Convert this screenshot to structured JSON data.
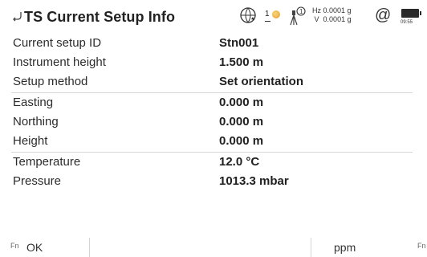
{
  "header": {
    "title": "TS Current Setup Info",
    "gnss_count": "1",
    "hz_label": "Hz",
    "hz_value": "0.0001 g",
    "v_label": "V",
    "v_value": "0.0001 g",
    "at_symbol": "@",
    "time": "09:55",
    "icons": [
      "back-icon",
      "globe-icon",
      "satellite-icon",
      "instrument-icon",
      "at-icon",
      "battery-icon"
    ]
  },
  "rows": [
    {
      "label": "Current setup ID",
      "value": "Stn001"
    },
    {
      "label": "Instrument height",
      "value": "1.500 m"
    },
    {
      "label": "Setup method",
      "value": "Set orientation"
    },
    {
      "label": "Easting",
      "value": "0.000 m"
    },
    {
      "label": "Northing",
      "value": "0.000 m"
    },
    {
      "label": "Height",
      "value": "0.000 m"
    },
    {
      "label": "Temperature",
      "value": "12.0 °C"
    },
    {
      "label": "Pressure",
      "value": "1013.3 mbar"
    }
  ],
  "footer": {
    "fn_left": "Fn",
    "ok": "OK",
    "ppm": "ppm",
    "fn_right": "Fn"
  },
  "colors": {
    "text": "#1f1f1f",
    "separator": "#d7d7d7",
    "battery": "#2a2a2a"
  }
}
